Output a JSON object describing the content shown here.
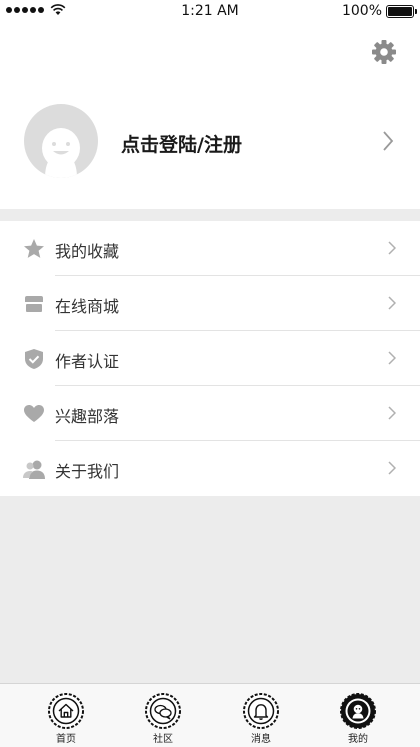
{
  "status_bar": {
    "time": "1:21 AM",
    "battery": "100%"
  },
  "profile": {
    "login_label": "点击登陆/注册"
  },
  "menu": [
    {
      "label": "我的收藏",
      "icon": "star-icon"
    },
    {
      "label": "在线商城",
      "icon": "store-icon"
    },
    {
      "label": "作者认证",
      "icon": "shield-check-icon"
    },
    {
      "label": "兴趣部落",
      "icon": "heart-icon"
    },
    {
      "label": "关于我们",
      "icon": "users-icon"
    }
  ],
  "tabbar": [
    {
      "label": "首页",
      "icon": "home-icon",
      "active": false
    },
    {
      "label": "社区",
      "icon": "chat-icon",
      "active": false
    },
    {
      "label": "消息",
      "icon": "bell-icon",
      "active": false
    },
    {
      "label": "我的",
      "icon": "person-icon",
      "active": true
    }
  ],
  "colors": {
    "icon_gray": "#a9a9a9",
    "background": "#ececec",
    "active_tab": "#111111"
  }
}
